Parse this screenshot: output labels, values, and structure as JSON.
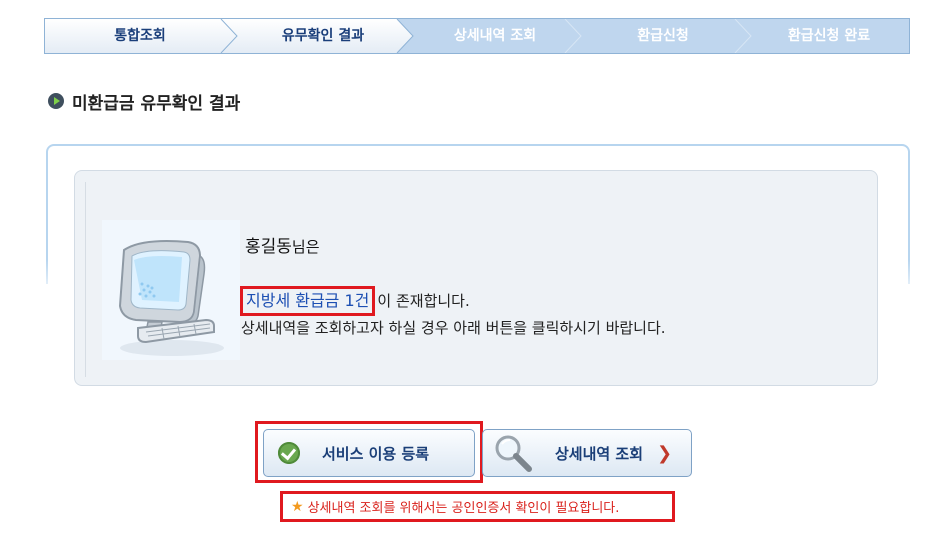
{
  "steps": [
    {
      "label": "통합조회",
      "state": "done"
    },
    {
      "label": "유무확인 결과",
      "state": "done"
    },
    {
      "label": "상세내역 조회",
      "state": "todo"
    },
    {
      "label": "환급신청",
      "state": "todo"
    },
    {
      "label": "환급신청 완료",
      "state": "todo"
    }
  ],
  "section": {
    "title": "미환급금 유무확인 결과"
  },
  "result": {
    "name": "홍길동",
    "name_suffix": "님은",
    "refund_link": "지방세 환급금 1건",
    "exists_text": "이 존재합니다.",
    "instruction": "상세내역을 조회하고자 하실 경우 아래 버튼을 클릭하시기 바랍니다."
  },
  "buttons": {
    "register": "서비스 이용 등록",
    "detail": "상세내역 조회"
  },
  "notice": "상세내역 조회를 위해서는 공인인증서 확인이 필요합니다.",
  "icons": {
    "section": "bullet-icon",
    "illustration": "computer-monitor-icon",
    "register": "check-icon",
    "detail": "magnifier-icon",
    "detail_arrow": "chevron-right-icon",
    "notice": "star-icon"
  },
  "colors": {
    "highlight_border": "#e0191f",
    "link_text": "#1c4fb3",
    "notice_text": "#d9221c",
    "step_done_text": "#1a3e7a",
    "step_todo_bg": "#bfd6ee"
  }
}
